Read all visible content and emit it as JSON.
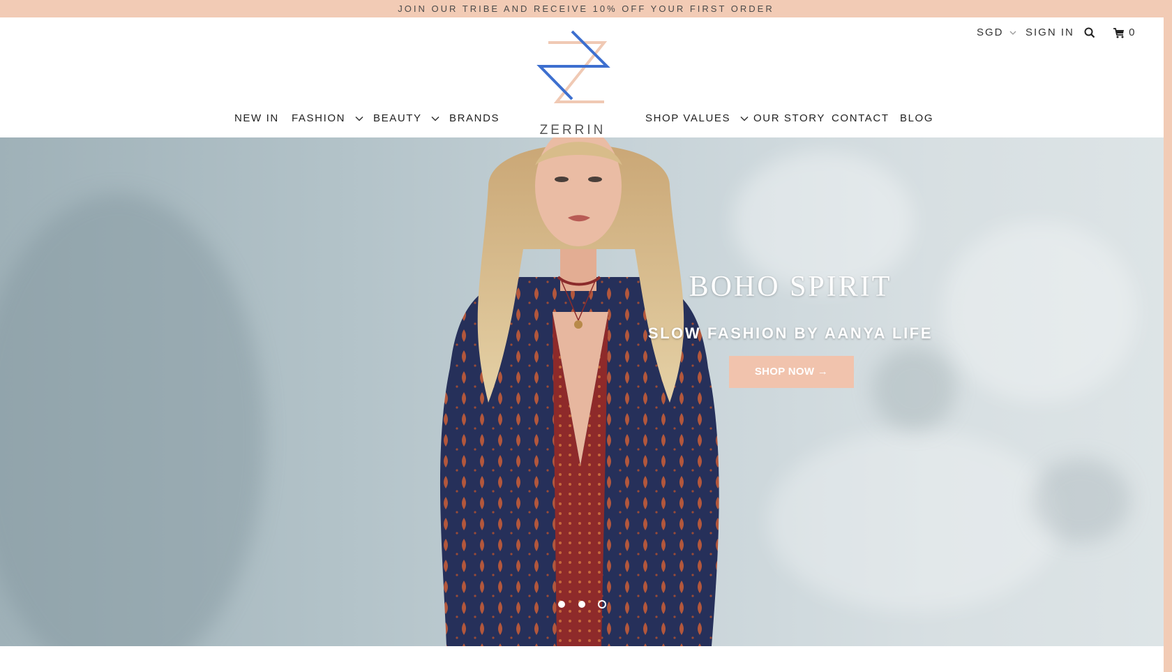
{
  "announcement": "JOIN OUR TRIBE AND RECEIVE 10% OFF YOUR FIRST ORDER",
  "brand": {
    "name": "ZERRIN",
    "accent": "#f2cbb5",
    "logo_blue": "#3d6fcf",
    "logo_peach": "#f0c9b4"
  },
  "utility": {
    "currency": "SGD",
    "sign_in": "SIGN IN",
    "cart_count": "0",
    "icons": [
      "chevron-down-icon",
      "search-icon",
      "cart-icon"
    ]
  },
  "nav": {
    "left": [
      {
        "label": "NEW IN",
        "dropdown": false
      },
      {
        "label": "FASHION",
        "dropdown": true
      },
      {
        "label": "BEAUTY",
        "dropdown": true
      },
      {
        "label": "BRANDS",
        "dropdown": false
      }
    ],
    "right": [
      {
        "label": "SHOP VALUES",
        "dropdown": true
      },
      {
        "label": "OUR STORY",
        "dropdown": false
      },
      {
        "label": "CONTACT",
        "dropdown": false
      },
      {
        "label": "BLOG",
        "dropdown": false
      }
    ]
  },
  "hero": {
    "title": "BOHO SPIRIT",
    "subtitle": "SLOW FASHION BY AANYA LIFE",
    "cta": "SHOP NOW →",
    "slide_count": 3,
    "active_slide": 3
  }
}
